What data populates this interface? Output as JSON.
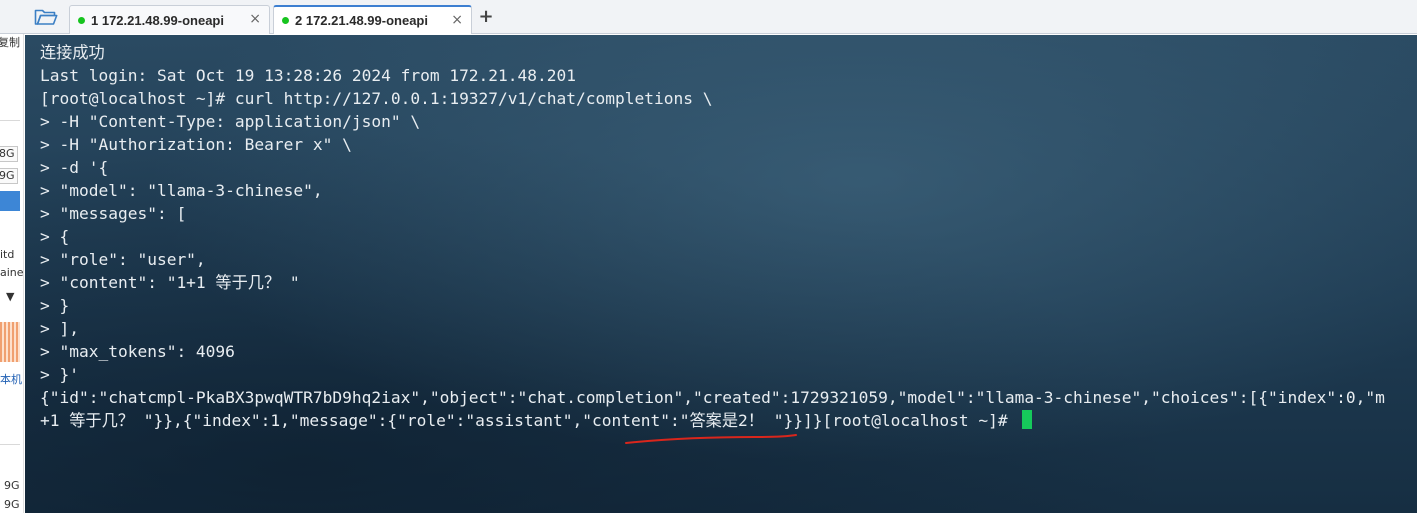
{
  "tabs": [
    {
      "label": "1 172.21.48.99-oneapi",
      "status_color": "#17c41f",
      "close": "×",
      "active": false
    },
    {
      "label": "2 172.21.48.99-oneapi",
      "status_color": "#17c41f",
      "close": "×",
      "active": true
    }
  ],
  "toolbar": {
    "open_icon": "folder-open-icon",
    "new_tab_label": "+"
  },
  "left_strip": [
    "复制",
    "8G",
    "9G",
    "itd",
    "aine",
    "本机",
    "9G",
    "9G"
  ],
  "terminal": {
    "lines": [
      "连接成功",
      "Last login: Sat Oct 19 13:28:26 2024 from 172.21.48.201",
      "[root@localhost ~]# curl http://127.0.0.1:19327/v1/chat/completions \\",
      "> -H \"Content-Type: application/json\" \\",
      "> -H \"Authorization: Bearer x\" \\",
      "> -d '{",
      "> \"model\": \"llama-3-chinese\",",
      "> \"messages\": [",
      "> {",
      "> \"role\": \"user\",",
      "> \"content\": \"1+1 等于几？ \"",
      "> }",
      "> ],",
      "> \"max_tokens\": 4096",
      "> }'",
      "{\"id\":\"chatcmpl-PkaBX3pwqWTR7bD9hq2iax\",\"object\":\"chat.completion\",\"created\":1729321059,\"model\":\"llama-3-chinese\",\"choices\":[{\"index\":0,\"m",
      "+1 等于几？ \"}},{\"index\":1,\"message\":{\"role\":\"assistant\",\"content\":\"答案是2！ \"}}]}[root@localhost ~]# "
    ],
    "cursor_color": "#16c95b",
    "annotation_color": "#d9261c"
  }
}
